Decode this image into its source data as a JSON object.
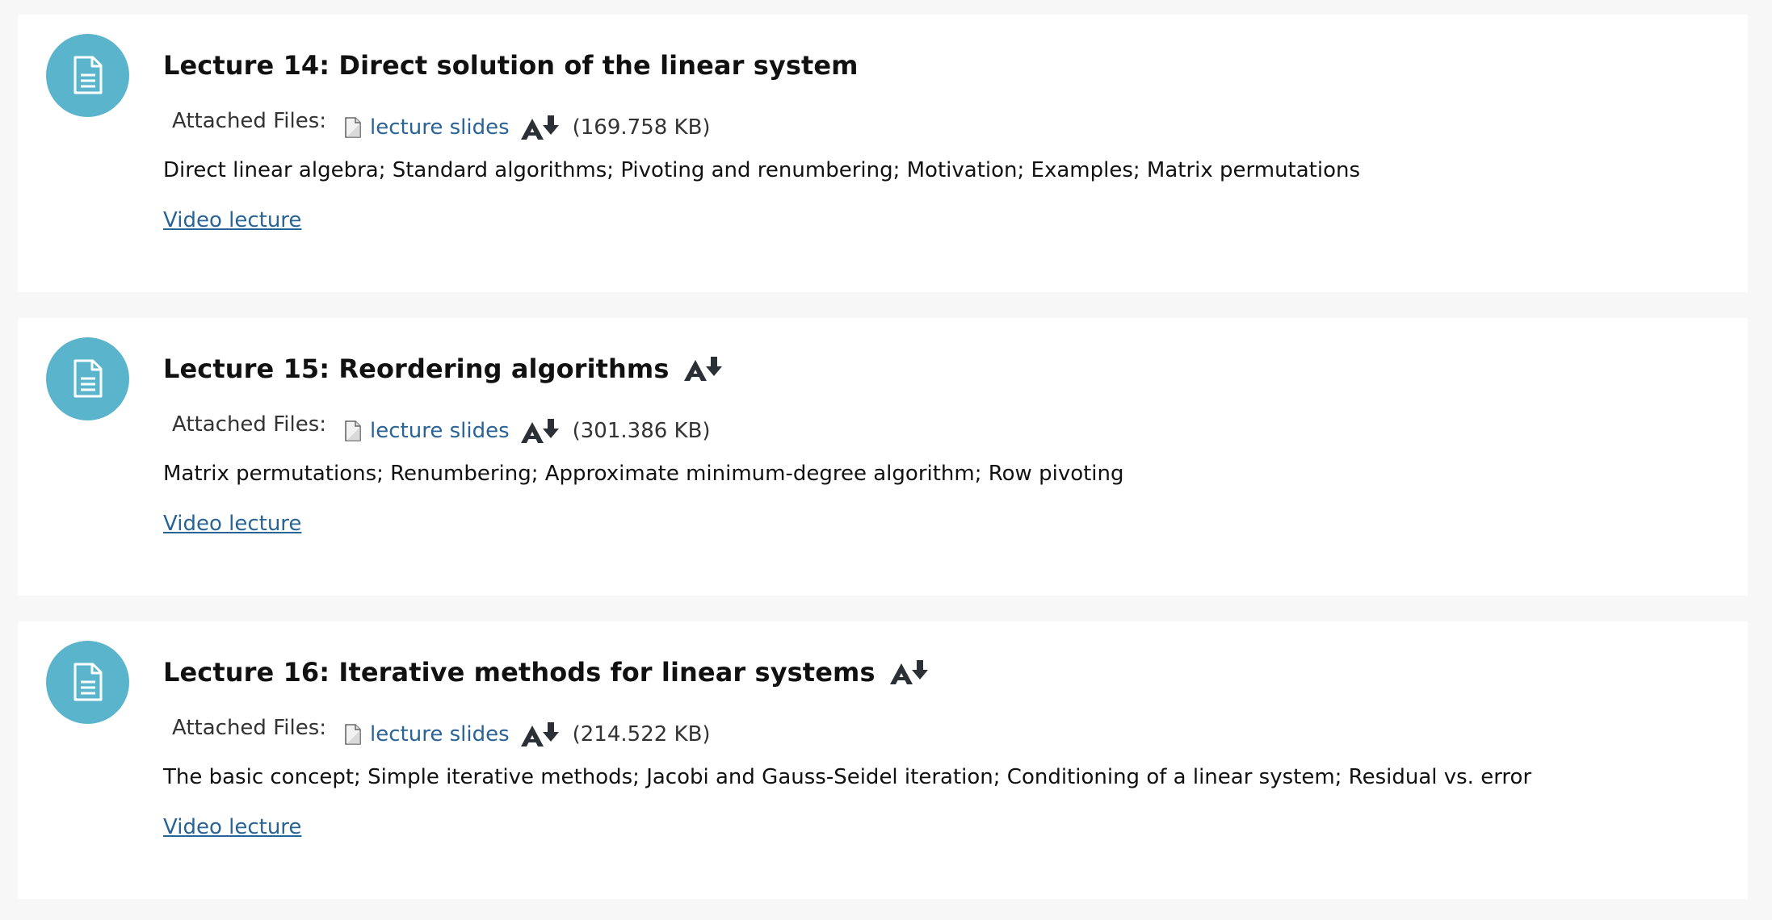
{
  "lectures": [
    {
      "title": "Lecture 14: Direct solution of the linear system",
      "has_title_download": false,
      "attached_files_label": "Attached Files:",
      "file_link": "lecture slides",
      "file_size": "(169.758 KB)",
      "description": "Direct linear algebra; Standard algorithms; Pivoting and renumbering; Motivation; Examples; Matrix permutations",
      "video_link": "Video lecture"
    },
    {
      "title": "Lecture 15: Reordering algorithms",
      "has_title_download": true,
      "attached_files_label": "Attached Files:",
      "file_link": "lecture slides",
      "file_size": "(301.386 KB)",
      "description": "Matrix permutations; Renumbering; Approximate minimum-degree algorithm; Row pivoting",
      "video_link": "Video lecture"
    },
    {
      "title": "Lecture 16: Iterative methods for linear systems",
      "has_title_download": true,
      "attached_files_label": "Attached Files:",
      "file_link": "lecture slides",
      "file_size": "(214.522 KB)",
      "description": "The basic concept; Simple iterative methods; Jacobi and Gauss-Seidel iteration; Conditioning of a linear system; Residual vs. error",
      "video_link": "Video lecture"
    }
  ],
  "icons": {
    "activity": "document-icon",
    "file": "file-icon",
    "download": "accessible-download-icon"
  },
  "colors": {
    "page_background": "#f7f7f7",
    "card_background": "#ffffff",
    "activity_icon_circle": "#5ab4cc",
    "link": "#2a6496",
    "download_icon": "#2b2f36"
  }
}
